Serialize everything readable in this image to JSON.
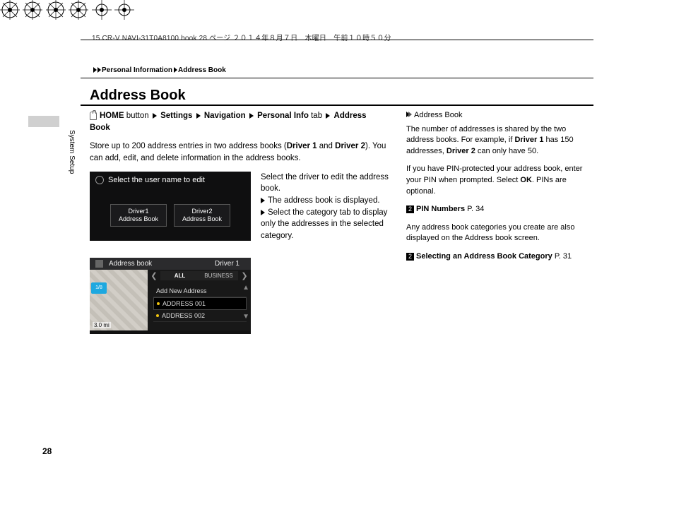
{
  "header": "15 CR-V NAVI-31T0A8100.book  28 ページ  ２０１４年８月７日　木曜日　午前１０時５０分",
  "breadcrumb": {
    "a": "Personal Information",
    "b": "Address Book"
  },
  "title": "Address Book",
  "sideLabel": "System Setup",
  "nav": {
    "home": "HOME",
    "homeSuffix": " button",
    "settings": "Settings",
    "navigation": "Navigation",
    "personal": "Personal Info",
    "personalSuffix": " tab",
    "address": "Address Book"
  },
  "body1a": "Store up to 200 address entries in two address books (",
  "body1b": "Driver 1",
  "body1c": " and ",
  "body1d": "Driver 2",
  "body1e": "). You can add, edit, and delete information in the address books.",
  "shot1": {
    "hdr": "Select the user name to edit",
    "b1a": "Driver1",
    "b1b": "Address Book",
    "b2a": "Driver2",
    "b2b": "Address Book"
  },
  "instr": {
    "p1": "Select the driver to edit the address book.",
    "p2": "The address book is displayed.",
    "p3": "Select the category tab to display only the addresses in the selected category."
  },
  "shot2": {
    "title": "Address book",
    "driver": "Driver 1",
    "badge": "1/8",
    "scale": "3.0 mi",
    "tab1": "ALL",
    "tab2": "BUSINESS",
    "li1": "Add New Address",
    "li2": "ADDRESS 001",
    "li3": "ADDRESS 002"
  },
  "side": {
    "hdr": "Address Book",
    "p1a": "The number of addresses is shared by the two address books. For example, if ",
    "p1b": "Driver 1",
    "p1c": " has 150 addresses, ",
    "p1d": "Driver 2",
    "p1e": " can only have 50.",
    "p2a": "If you have PIN-protected your address book, enter your PIN when prompted. Select ",
    "p2b": "OK",
    "p2c": ". PINs are optional.",
    "link1": "PIN Numbers",
    "link1p": " P. 34",
    "p3": "Any address book categories you create are also displayed on the Address book screen.",
    "link2": "Selecting an Address Book Category",
    "link2p": " P. 31"
  },
  "pageNum": "28"
}
